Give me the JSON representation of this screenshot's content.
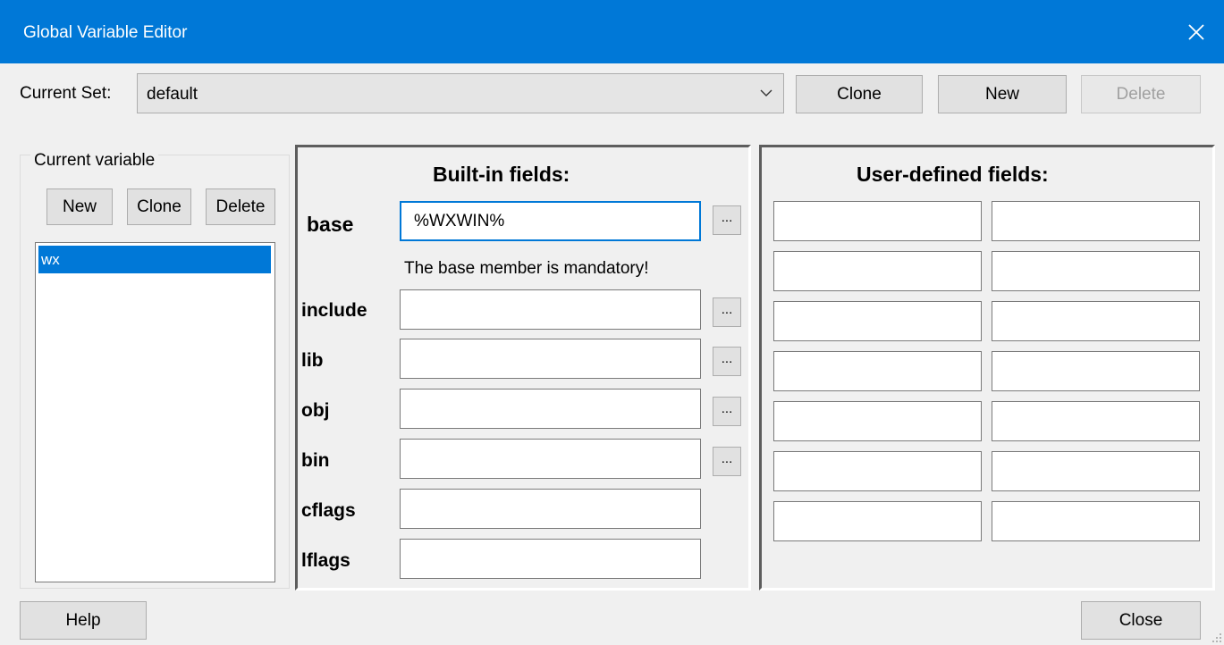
{
  "window": {
    "title": "Global Variable Editor"
  },
  "set": {
    "label": "Current Set:",
    "selected": "default",
    "clone_label": "Clone",
    "new_label": "New",
    "delete_label": "Delete"
  },
  "variable": {
    "group_label": "Current variable",
    "new_label": "New",
    "clone_label": "Clone",
    "delete_label": "Delete",
    "items": [
      "wx"
    ]
  },
  "builtin": {
    "heading": "Built-in fields:",
    "base_label": "base",
    "base_value": "%WXWIN%",
    "mandatory_note": "The base member is mandatory!",
    "browse_label": "...",
    "include_label": "include",
    "lib_label": "lib",
    "obj_label": "obj",
    "bin_label": "bin",
    "cflags_label": "cflags",
    "lflags_label": "lflags"
  },
  "user": {
    "heading": "User-defined fields:"
  },
  "footer": {
    "help_label": "Help",
    "close_label": "Close"
  }
}
